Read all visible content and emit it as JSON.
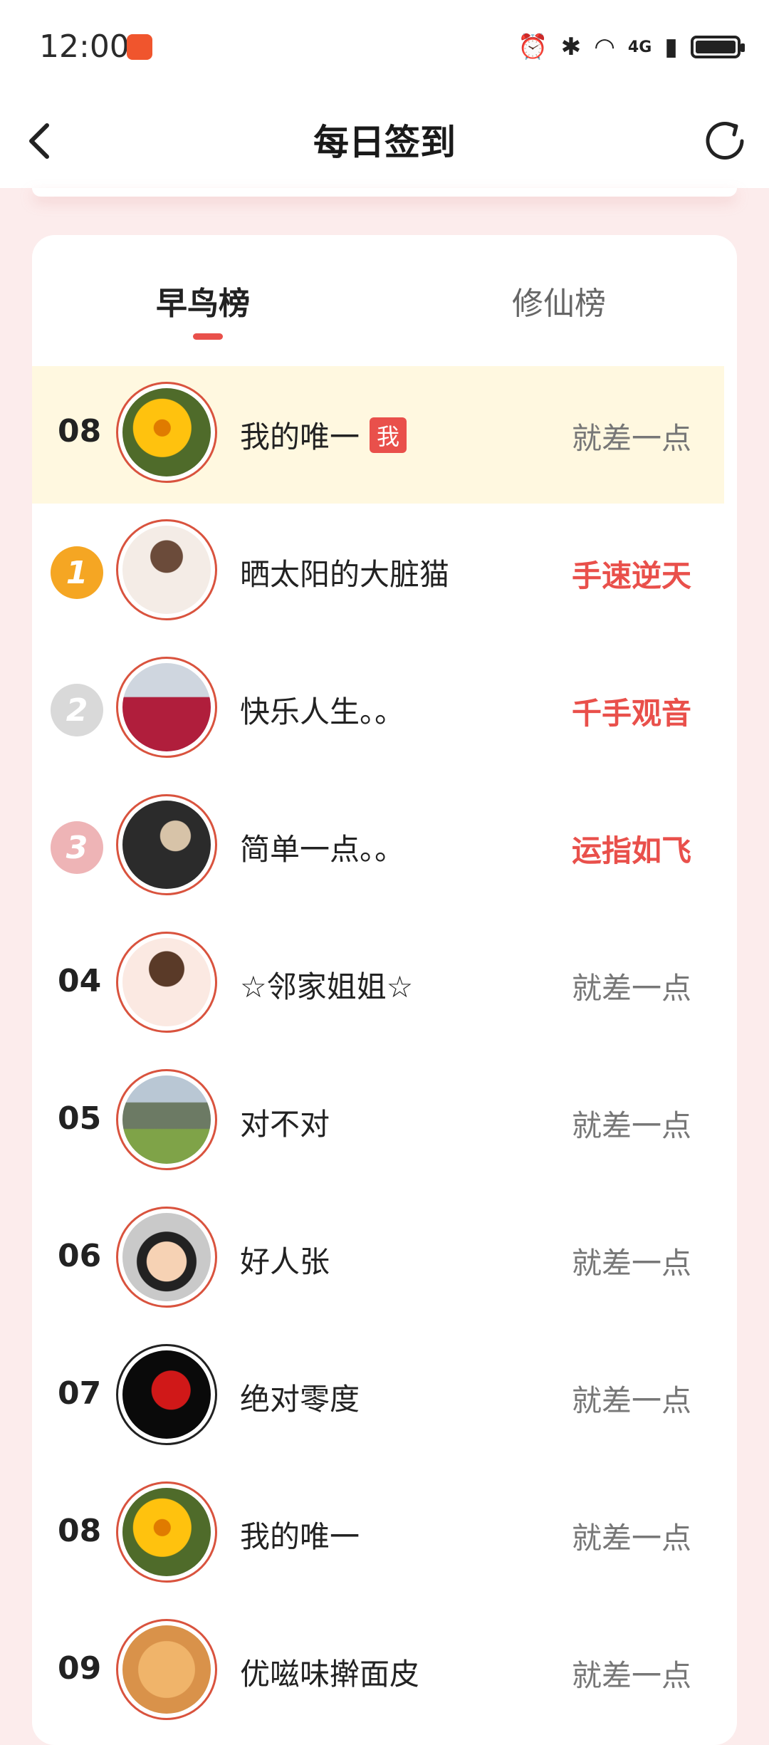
{
  "status_bar": {
    "time": "12:00",
    "icons": [
      "recorder-icon",
      "alarm-icon",
      "bluetooth-icon",
      "wifi-icon",
      "signal-4g-icon",
      "battery-charging-icon"
    ],
    "network": "4G"
  },
  "nav": {
    "title": "每日签到",
    "back_icon": "chevron-left-icon",
    "refresh_icon": "refresh-icon"
  },
  "tabs": [
    {
      "label": "早鸟榜",
      "active": true
    },
    {
      "label": "修仙榜",
      "active": false
    }
  ],
  "accent_color": "#e9504b",
  "leaderboard": [
    {
      "rank": "08",
      "name": "我的唯一",
      "badge": "我",
      "status": "就差一点",
      "highlight": true,
      "avatar": "sunflower"
    },
    {
      "rank": "1",
      "medal": "gold",
      "name": "晒太阳的大脏猫",
      "status": "手速逆天",
      "avatar": "flower-hair"
    },
    {
      "rank": "2",
      "medal": "silver",
      "name": "快乐人生。。",
      "status": "千手观音",
      "avatar": "flower-field"
    },
    {
      "rank": "3",
      "medal": "bronze",
      "name": "简单一点。。",
      "status": "运指如飞",
      "avatar": "grass"
    },
    {
      "rank": "04",
      "name": "☆邻家姐姐☆",
      "status": "就差一点",
      "avatar": "cartoon-girl"
    },
    {
      "rank": "05",
      "name": "对不对",
      "status": "就差一点",
      "avatar": "mountain"
    },
    {
      "rank": "06",
      "name": "好人张",
      "status": "就差一点",
      "avatar": "cartoon-boy"
    },
    {
      "rank": "07",
      "name": "绝对零度",
      "status": "就差一点",
      "avatar": "nerv-logo"
    },
    {
      "rank": "08",
      "name": "我的唯一",
      "status": "就差一点",
      "avatar": "sunflower"
    },
    {
      "rank": "09",
      "name": "优嗞味擀面皮",
      "status": "就差一点",
      "avatar": "noodles"
    }
  ]
}
